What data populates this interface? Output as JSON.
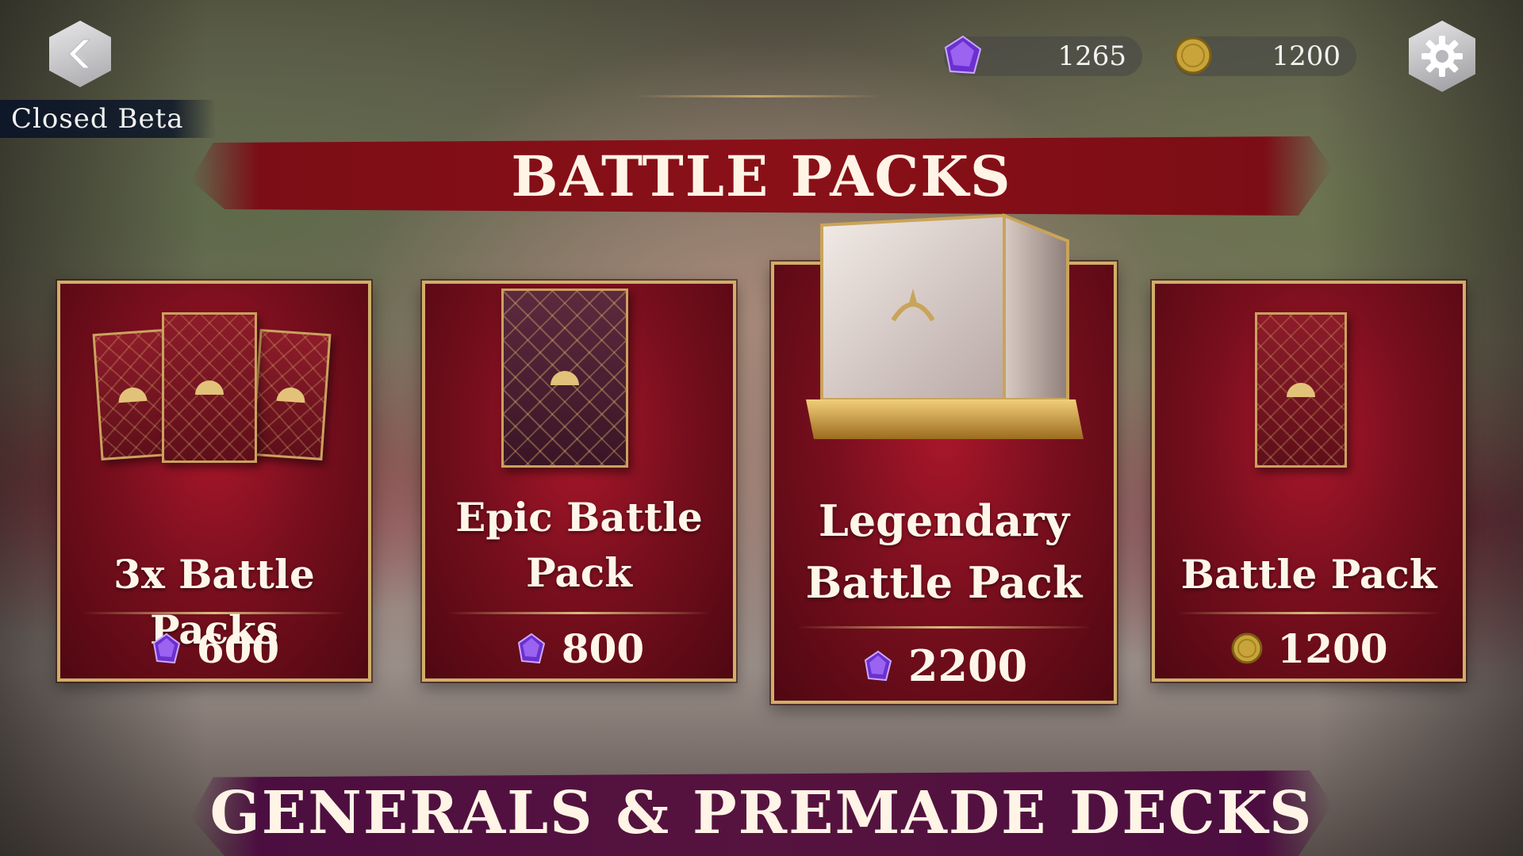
{
  "hud": {
    "beta_label": "Closed Beta",
    "gems": "1265",
    "gold": "1200"
  },
  "sections": {
    "battle_packs_title": "BATTLE PACKS",
    "generals_title": "GENERALS & PREMADE DECKS"
  },
  "packs": [
    {
      "title": "3x Battle Packs",
      "price": "600",
      "currency": "gem"
    },
    {
      "title_line1": "Epic Battle",
      "title_line2": "Pack",
      "price": "800",
      "currency": "gem"
    },
    {
      "title_line1": "Legendary",
      "title_line2": "Battle Pack",
      "price": "2200",
      "currency": "gem"
    },
    {
      "title": "Battle Pack",
      "price": "1200",
      "currency": "gold"
    }
  ],
  "colors": {
    "gem": "#7b3fd6",
    "gold": "#c9a43a",
    "banner_red": "#8a1018",
    "banner_purple": "#57133f",
    "card_border": "#cfae6a"
  },
  "icons": {
    "back": "back-arrow-icon",
    "settings": "gear-icon",
    "gem": "gem-icon",
    "coin": "coin-icon"
  }
}
